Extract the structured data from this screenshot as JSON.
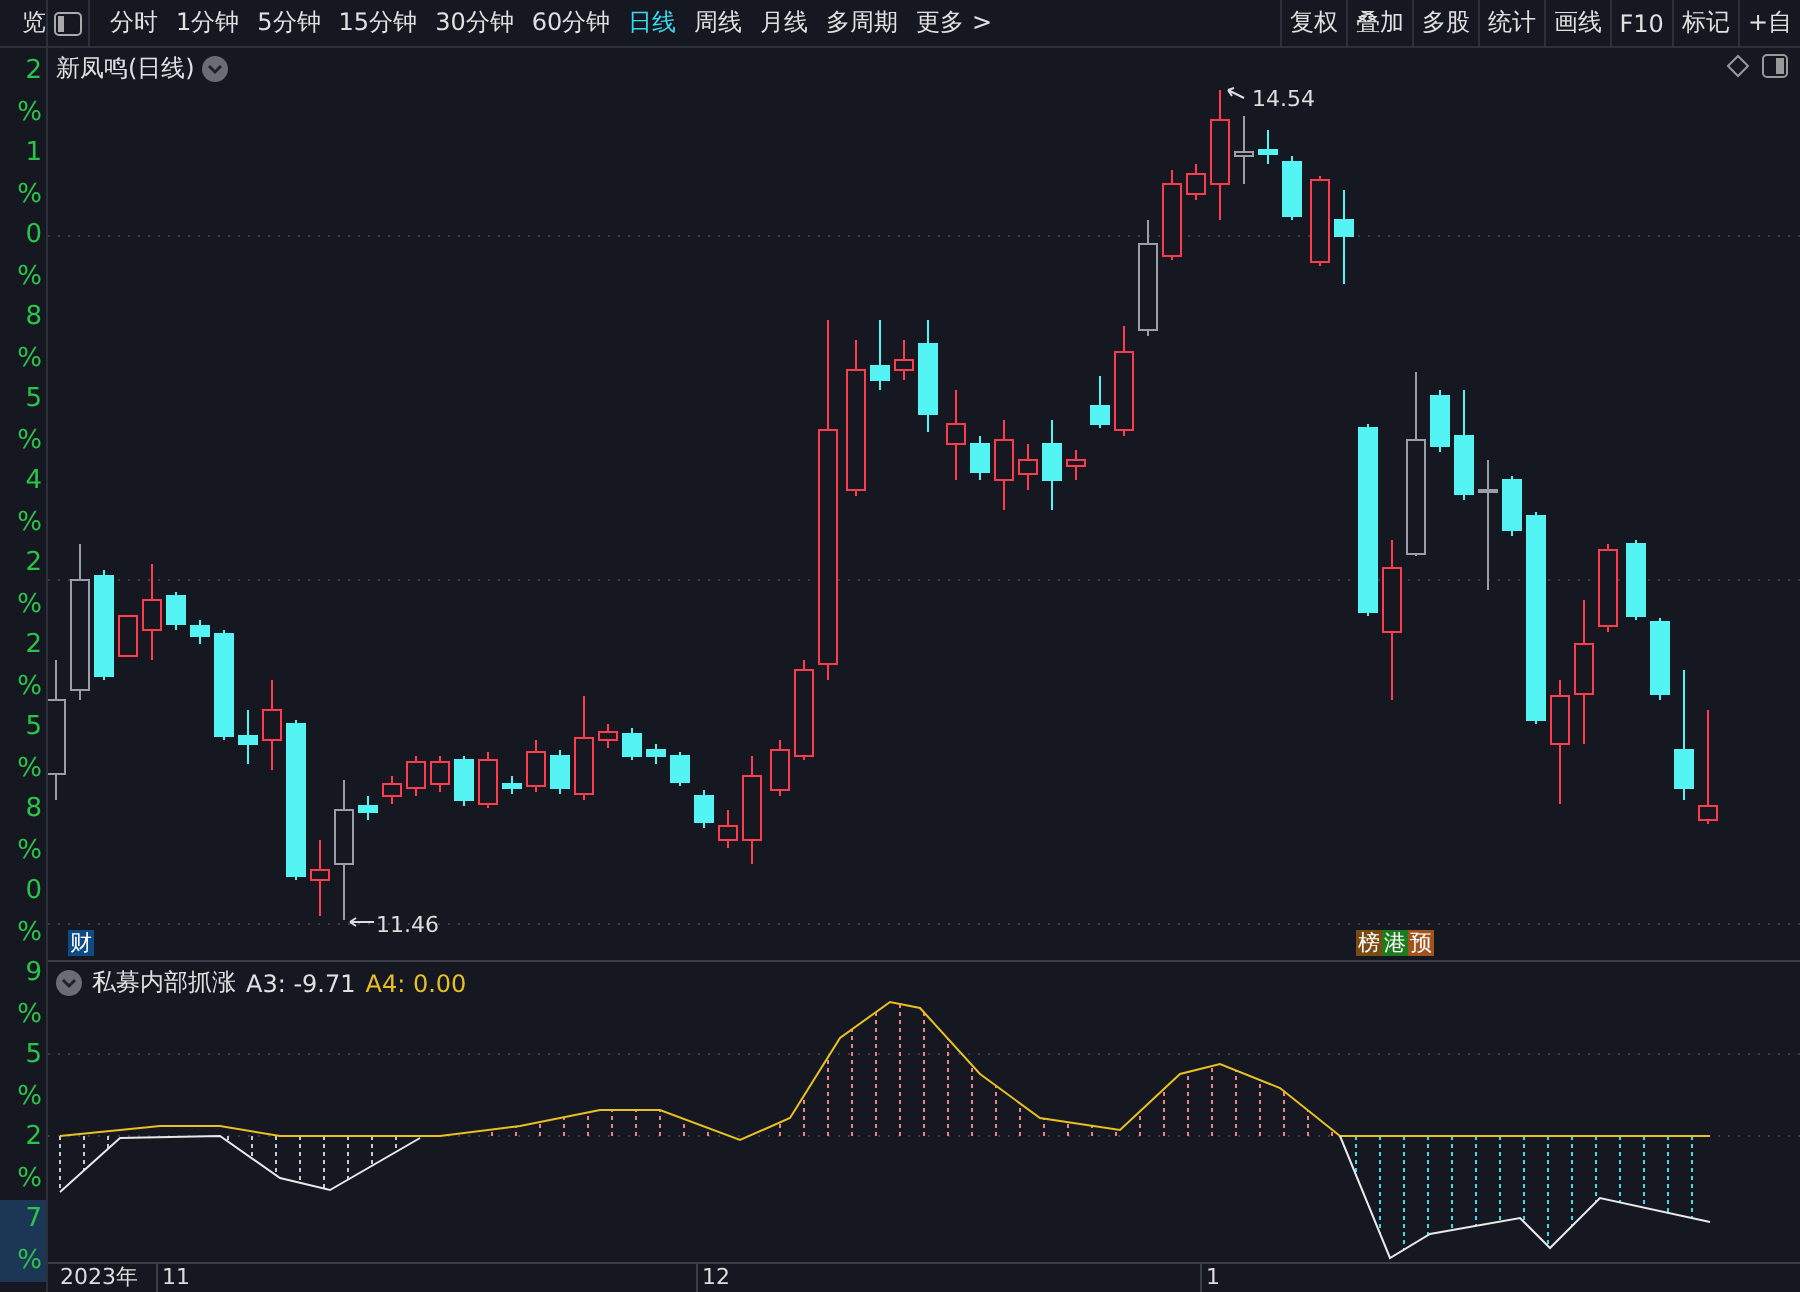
{
  "toolbar": {
    "cut_label": "览",
    "periods": [
      {
        "label": "分时",
        "selected": false
      },
      {
        "label": "1分钟",
        "selected": false
      },
      {
        "label": "5分钟",
        "selected": false
      },
      {
        "label": "15分钟",
        "selected": false
      },
      {
        "label": "30分钟",
        "selected": false
      },
      {
        "label": "60分钟",
        "selected": false
      },
      {
        "label": "日线",
        "selected": true
      },
      {
        "label": "周线",
        "selected": false
      },
      {
        "label": "月线",
        "selected": false
      },
      {
        "label": "多周期",
        "selected": false
      }
    ],
    "more": "更多 >",
    "tools": [
      "复权",
      "叠加",
      "多股",
      "统计",
      "画线",
      "F10",
      "标记",
      "+自"
    ]
  },
  "price_axis": [
    {
      "value": "2",
      "unit": "%",
      "highlighted": false
    },
    {
      "value": "1",
      "unit": "%",
      "highlighted": false
    },
    {
      "value": "0",
      "unit": "%",
      "highlighted": false
    },
    {
      "value": "8",
      "unit": "%",
      "highlighted": false
    },
    {
      "value": "5",
      "unit": "%",
      "highlighted": false
    },
    {
      "value": "4",
      "unit": "%",
      "highlighted": false
    },
    {
      "value": "2",
      "unit": "%",
      "highlighted": false
    },
    {
      "value": "2",
      "unit": "%",
      "highlighted": false
    },
    {
      "value": "5",
      "unit": "%",
      "highlighted": false
    },
    {
      "value": "8",
      "unit": "%",
      "highlighted": false
    },
    {
      "value": "0",
      "unit": "%",
      "highlighted": false
    },
    {
      "value": "9",
      "unit": "%",
      "highlighted": false
    },
    {
      "value": "5",
      "unit": "%",
      "highlighted": false
    },
    {
      "value": "2",
      "unit": "%",
      "highlighted": false
    },
    {
      "value": "7",
      "unit": "%",
      "highlighted": true
    }
  ],
  "chart": {
    "title": "新凤鸣(日线)",
    "high_label": "14.54",
    "low_label": "11.46",
    "finance_badge": "财",
    "event_badges": [
      {
        "text": "榜",
        "color": "#7a4a12"
      },
      {
        "text": "港",
        "color": "#1d7a1d"
      },
      {
        "text": "预",
        "color": "#a2521c"
      }
    ]
  },
  "indicator": {
    "name": "私募内部抓涨",
    "a3": "A3: -9.71",
    "a4": "A4: 0.00"
  },
  "time_axis": {
    "year": "2023年",
    "months": [
      "11",
      "12",
      "1"
    ]
  }
}
